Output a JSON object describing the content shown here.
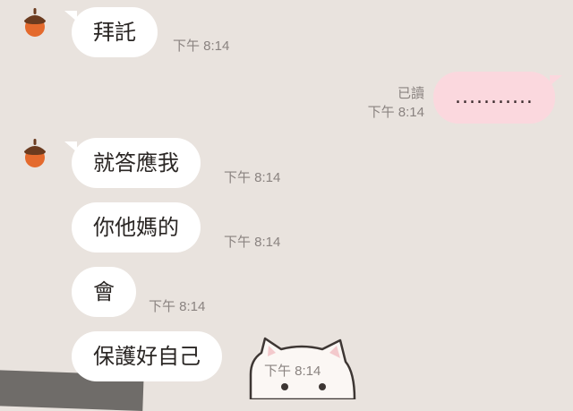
{
  "messages": [
    {
      "side": "left",
      "text": "拜託",
      "time": "下午 8:14",
      "has_avatar": true
    },
    {
      "side": "right",
      "text": "...........",
      "time": "下午 8:14",
      "read": "已讀"
    },
    {
      "side": "left",
      "text": "就答應我",
      "time": "下午 8:14",
      "has_avatar": true
    },
    {
      "side": "left",
      "text": "你他媽的",
      "time": "下午 8:14"
    },
    {
      "side": "left",
      "text": "會",
      "time": "下午 8:14"
    },
    {
      "side": "left",
      "text": "保護好自己",
      "time": "下午 8:14"
    }
  ],
  "colors": {
    "background": "#e9e3de",
    "incoming_bubble": "#ffffff",
    "outgoing_bubble": "#fbd8de",
    "timestamp": "#8a8380"
  },
  "icons": [
    "acorn-avatar-icon",
    "cat-sticker-icon"
  ]
}
